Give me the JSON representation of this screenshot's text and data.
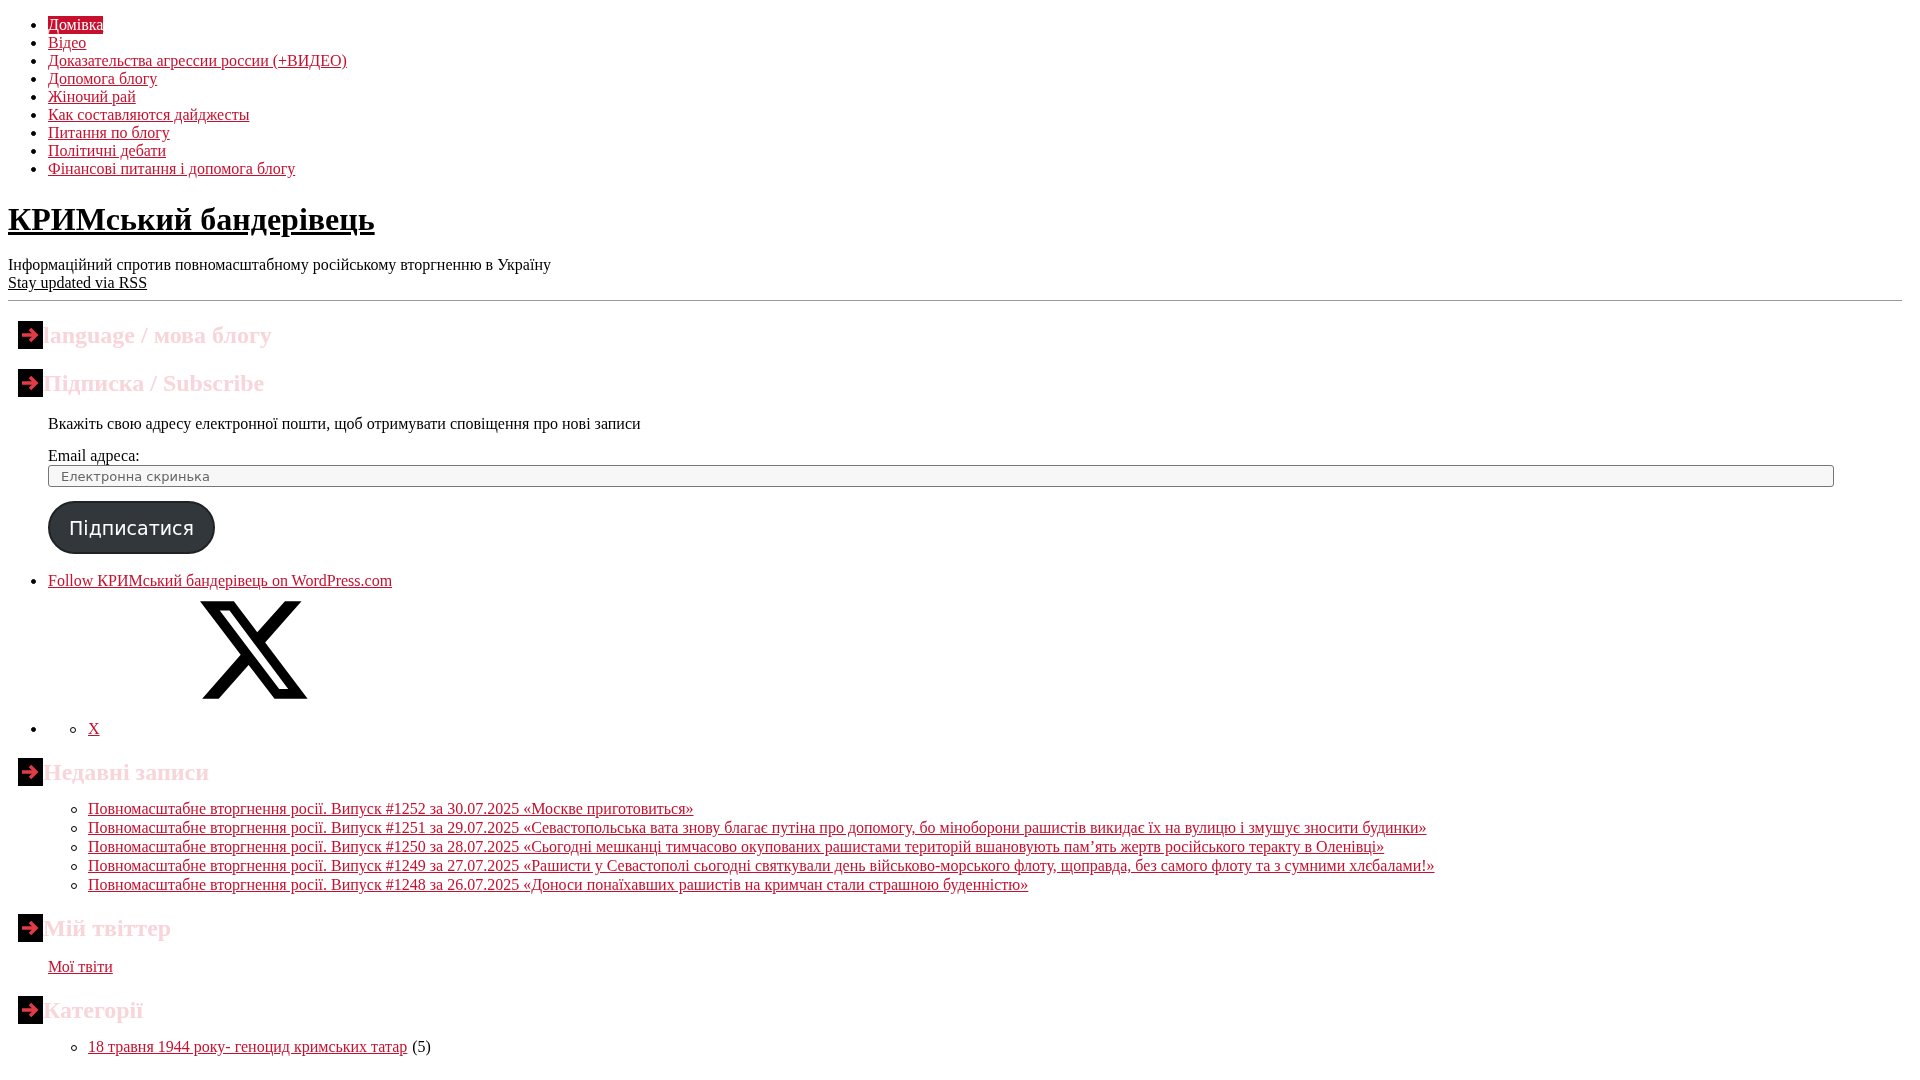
{
  "nav": [
    {
      "label": "Домівка",
      "selected": true
    },
    {
      "label": "Відео",
      "selected": false
    },
    {
      "label": "Доказательства агрессии россии (+ВИДЕО)",
      "selected": false
    },
    {
      "label": "Допомога блогу",
      "selected": false
    },
    {
      "label": "Жіночий рай",
      "selected": false
    },
    {
      "label": "Как составляются дайджесты",
      "selected": false
    },
    {
      "label": "Питання по блогу",
      "selected": false
    },
    {
      "label": "Політичні дебати",
      "selected": false
    },
    {
      "label": "Фінансові питання і допомога блогу",
      "selected": false
    }
  ],
  "site": {
    "title": "КРИМський бандерівець",
    "tagline": "Інформаційний спротив повномасштабному російському вторгненню в Україну",
    "rss_link": "Stay updated via RSS"
  },
  "widgets": [
    {
      "kind": "empty",
      "title": "language / мова блогу"
    },
    {
      "kind": "subscribe",
      "title": "Підписка / Subscribe",
      "text": "Вкажіть свою адресу електронної пошти, щоб отримувати сповіщення про нові записи",
      "email_label": "Email адреса:",
      "email_placeholder": "Електронна скринька",
      "button": "Підписатися",
      "follow_link": "Follow КРИМський бандерівець on WordPress.com",
      "social": [
        {
          "label": "X"
        }
      ]
    },
    {
      "kind": "posts",
      "title": "Недавні записи",
      "items": [
        {
          "label": "Повномасштабне вторгнення росії. Випуск #1252 за 30.07.2025 «Москве приготовиться»"
        },
        {
          "label": "Повномасштабне вторгнення росії. Випуск #1251 за 29.07.2025 «Севастопольська вата знову благає путіна про допомогу, бо міноборони рашистів викидає їх на вулицю і змушує зносити будинки»"
        },
        {
          "label": "Повномасштабне вторгнення росії. Випуск #1250 за 28.07.2025 «Сьогодні мешканці тимчасово окупованих рашистами територій вшановують памʼять жертв російського теракту в Оленівці»"
        },
        {
          "label": "Повномасштабне вторгнення росії. Випуск #1249 за 27.07.2025 «Рашисти у Севастополі сьогодні святкували день військово-морського флоту, щоправда, без самого флоту та з сумними хлєбалами!»"
        },
        {
          "label": "Повномасштабне вторгнення росії. Випуск #1248 за 26.07.2025 «Доноси понаїхавших рашистів на кримчан стали страшною буденністю»"
        }
      ]
    },
    {
      "kind": "links",
      "title": "Мій твіттер",
      "items": [
        {
          "label": "Мої твіти"
        }
      ]
    },
    {
      "kind": "categories",
      "title": "Категорії",
      "items": [
        {
          "label": "18 травня 1944 року- геноцид кримських татар",
          "count": "(5)"
        }
      ]
    }
  ]
}
